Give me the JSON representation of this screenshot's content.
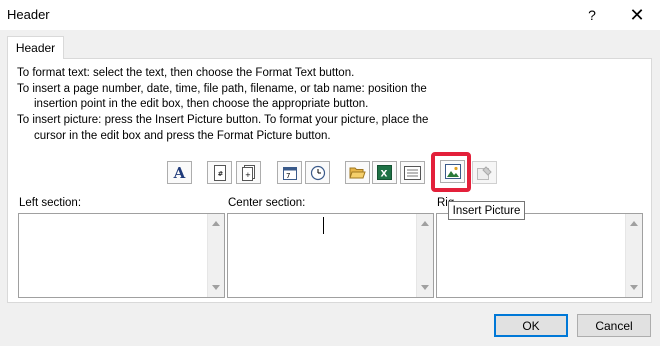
{
  "window": {
    "title": "Header",
    "help_label": "?",
    "close_label": "✕"
  },
  "tab": {
    "label": "Header"
  },
  "instructions": [
    "To format text:  select the text, then choose the Format Text button.",
    "To insert a page number, date, time, file path, filename, or tab name:  position the",
    "insertion point in the edit box, then choose the appropriate button.",
    "To insert picture: press the Insert Picture button.  To format your picture, place the",
    "cursor in the edit box and press the Format Picture button."
  ],
  "toolbar": {
    "icons": [
      "format-text-icon",
      "page-number-icon",
      "number-of-pages-icon",
      "date-icon",
      "time-icon",
      "file-path-icon",
      "filename-icon",
      "sheet-name-icon",
      "insert-picture-icon",
      "format-picture-icon"
    ],
    "format_text_glyph": "A",
    "tooltip": "Insert Picture",
    "highlight_color": "#e3203a"
  },
  "sections": {
    "left_label": "Left section:",
    "center_label": "Center section:",
    "right_label": "Rig"
  },
  "buttons": {
    "ok": "OK",
    "cancel": "Cancel"
  }
}
